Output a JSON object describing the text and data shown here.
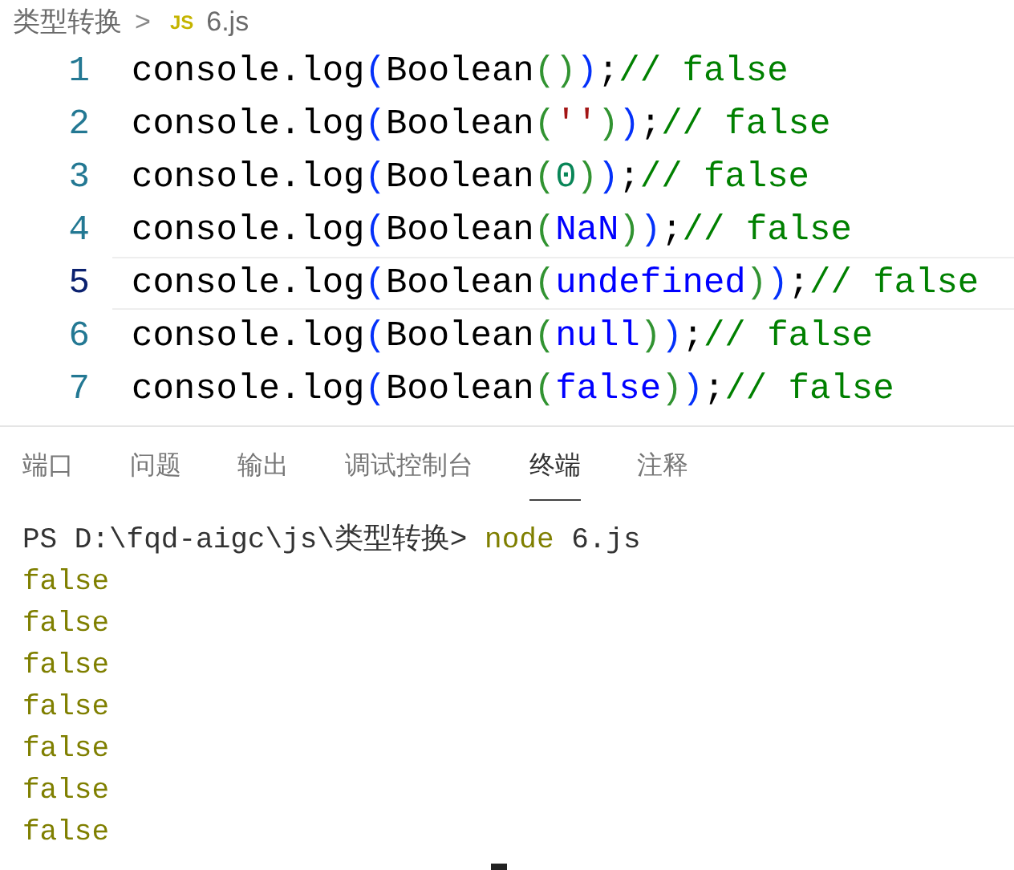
{
  "breadcrumb": {
    "folder": "类型转换",
    "separator": ">",
    "file_icon": "JS",
    "file": "6.js"
  },
  "editor": {
    "lines": [
      {
        "number": "1",
        "current": false,
        "tokens": [
          {
            "kind": "plain",
            "text": "console.log"
          },
          {
            "kind": "bracket1",
            "text": "("
          },
          {
            "kind": "plain",
            "text": "Boolean"
          },
          {
            "kind": "bracket2",
            "text": "()"
          },
          {
            "kind": "bracket1",
            "text": ")"
          },
          {
            "kind": "plain",
            "text": ";"
          },
          {
            "kind": "comment",
            "text": "// false"
          }
        ]
      },
      {
        "number": "2",
        "current": false,
        "tokens": [
          {
            "kind": "plain",
            "text": "console.log"
          },
          {
            "kind": "bracket1",
            "text": "("
          },
          {
            "kind": "plain",
            "text": "Boolean"
          },
          {
            "kind": "bracket2",
            "text": "("
          },
          {
            "kind": "string",
            "text": "''"
          },
          {
            "kind": "bracket2",
            "text": ")"
          },
          {
            "kind": "bracket1",
            "text": ")"
          },
          {
            "kind": "plain",
            "text": ";"
          },
          {
            "kind": "comment",
            "text": "// false"
          }
        ]
      },
      {
        "number": "3",
        "current": false,
        "tokens": [
          {
            "kind": "plain",
            "text": "console.log"
          },
          {
            "kind": "bracket1",
            "text": "("
          },
          {
            "kind": "plain",
            "text": "Boolean"
          },
          {
            "kind": "bracket2",
            "text": "("
          },
          {
            "kind": "number",
            "text": "0"
          },
          {
            "kind": "bracket2",
            "text": ")"
          },
          {
            "kind": "bracket1",
            "text": ")"
          },
          {
            "kind": "plain",
            "text": ";"
          },
          {
            "kind": "comment",
            "text": "// false"
          }
        ]
      },
      {
        "number": "4",
        "current": false,
        "tokens": [
          {
            "kind": "plain",
            "text": "console.log"
          },
          {
            "kind": "bracket1",
            "text": "("
          },
          {
            "kind": "plain",
            "text": "Boolean"
          },
          {
            "kind": "bracket2",
            "text": "("
          },
          {
            "kind": "keyword",
            "text": "NaN"
          },
          {
            "kind": "bracket2",
            "text": ")"
          },
          {
            "kind": "bracket1",
            "text": ")"
          },
          {
            "kind": "plain",
            "text": ";"
          },
          {
            "kind": "comment",
            "text": "// false"
          }
        ]
      },
      {
        "number": "5",
        "current": true,
        "tokens": [
          {
            "kind": "plain",
            "text": "console.log"
          },
          {
            "kind": "bracket1",
            "text": "("
          },
          {
            "kind": "plain",
            "text": "Boolean"
          },
          {
            "kind": "bracket2",
            "text": "("
          },
          {
            "kind": "keyword",
            "text": "undefined"
          },
          {
            "kind": "bracket2",
            "text": ")"
          },
          {
            "kind": "bracket1",
            "text": ")"
          },
          {
            "kind": "plain",
            "text": ";"
          },
          {
            "kind": "comment",
            "text": "// false"
          }
        ]
      },
      {
        "number": "6",
        "current": false,
        "tokens": [
          {
            "kind": "plain",
            "text": "console.log"
          },
          {
            "kind": "bracket1",
            "text": "("
          },
          {
            "kind": "plain",
            "text": "Boolean"
          },
          {
            "kind": "bracket2",
            "text": "("
          },
          {
            "kind": "keyword",
            "text": "null"
          },
          {
            "kind": "bracket2",
            "text": ")"
          },
          {
            "kind": "bracket1",
            "text": ")"
          },
          {
            "kind": "plain",
            "text": ";"
          },
          {
            "kind": "comment",
            "text": "// false"
          }
        ]
      },
      {
        "number": "7",
        "current": false,
        "tokens": [
          {
            "kind": "plain",
            "text": "console.log"
          },
          {
            "kind": "bracket1",
            "text": "("
          },
          {
            "kind": "plain",
            "text": "Boolean"
          },
          {
            "kind": "bracket2",
            "text": "("
          },
          {
            "kind": "keyword",
            "text": "false"
          },
          {
            "kind": "bracket2",
            "text": ")"
          },
          {
            "kind": "bracket1",
            "text": ")"
          },
          {
            "kind": "plain",
            "text": ";"
          },
          {
            "kind": "comment",
            "text": "// false"
          }
        ]
      }
    ]
  },
  "panel_tabs": [
    {
      "label": "端口",
      "selected": false
    },
    {
      "label": "问题",
      "selected": false
    },
    {
      "label": "输出",
      "selected": false
    },
    {
      "label": "调试控制台",
      "selected": false
    },
    {
      "label": "终端",
      "selected": true
    },
    {
      "label": "注释",
      "selected": false
    }
  ],
  "terminal": {
    "prompt": "PS D:\\fqd-aigc\\js\\类型转换>",
    "command": "node",
    "args": "6.js",
    "output": [
      "false",
      "false",
      "false",
      "false",
      "false",
      "false",
      "false"
    ]
  }
}
